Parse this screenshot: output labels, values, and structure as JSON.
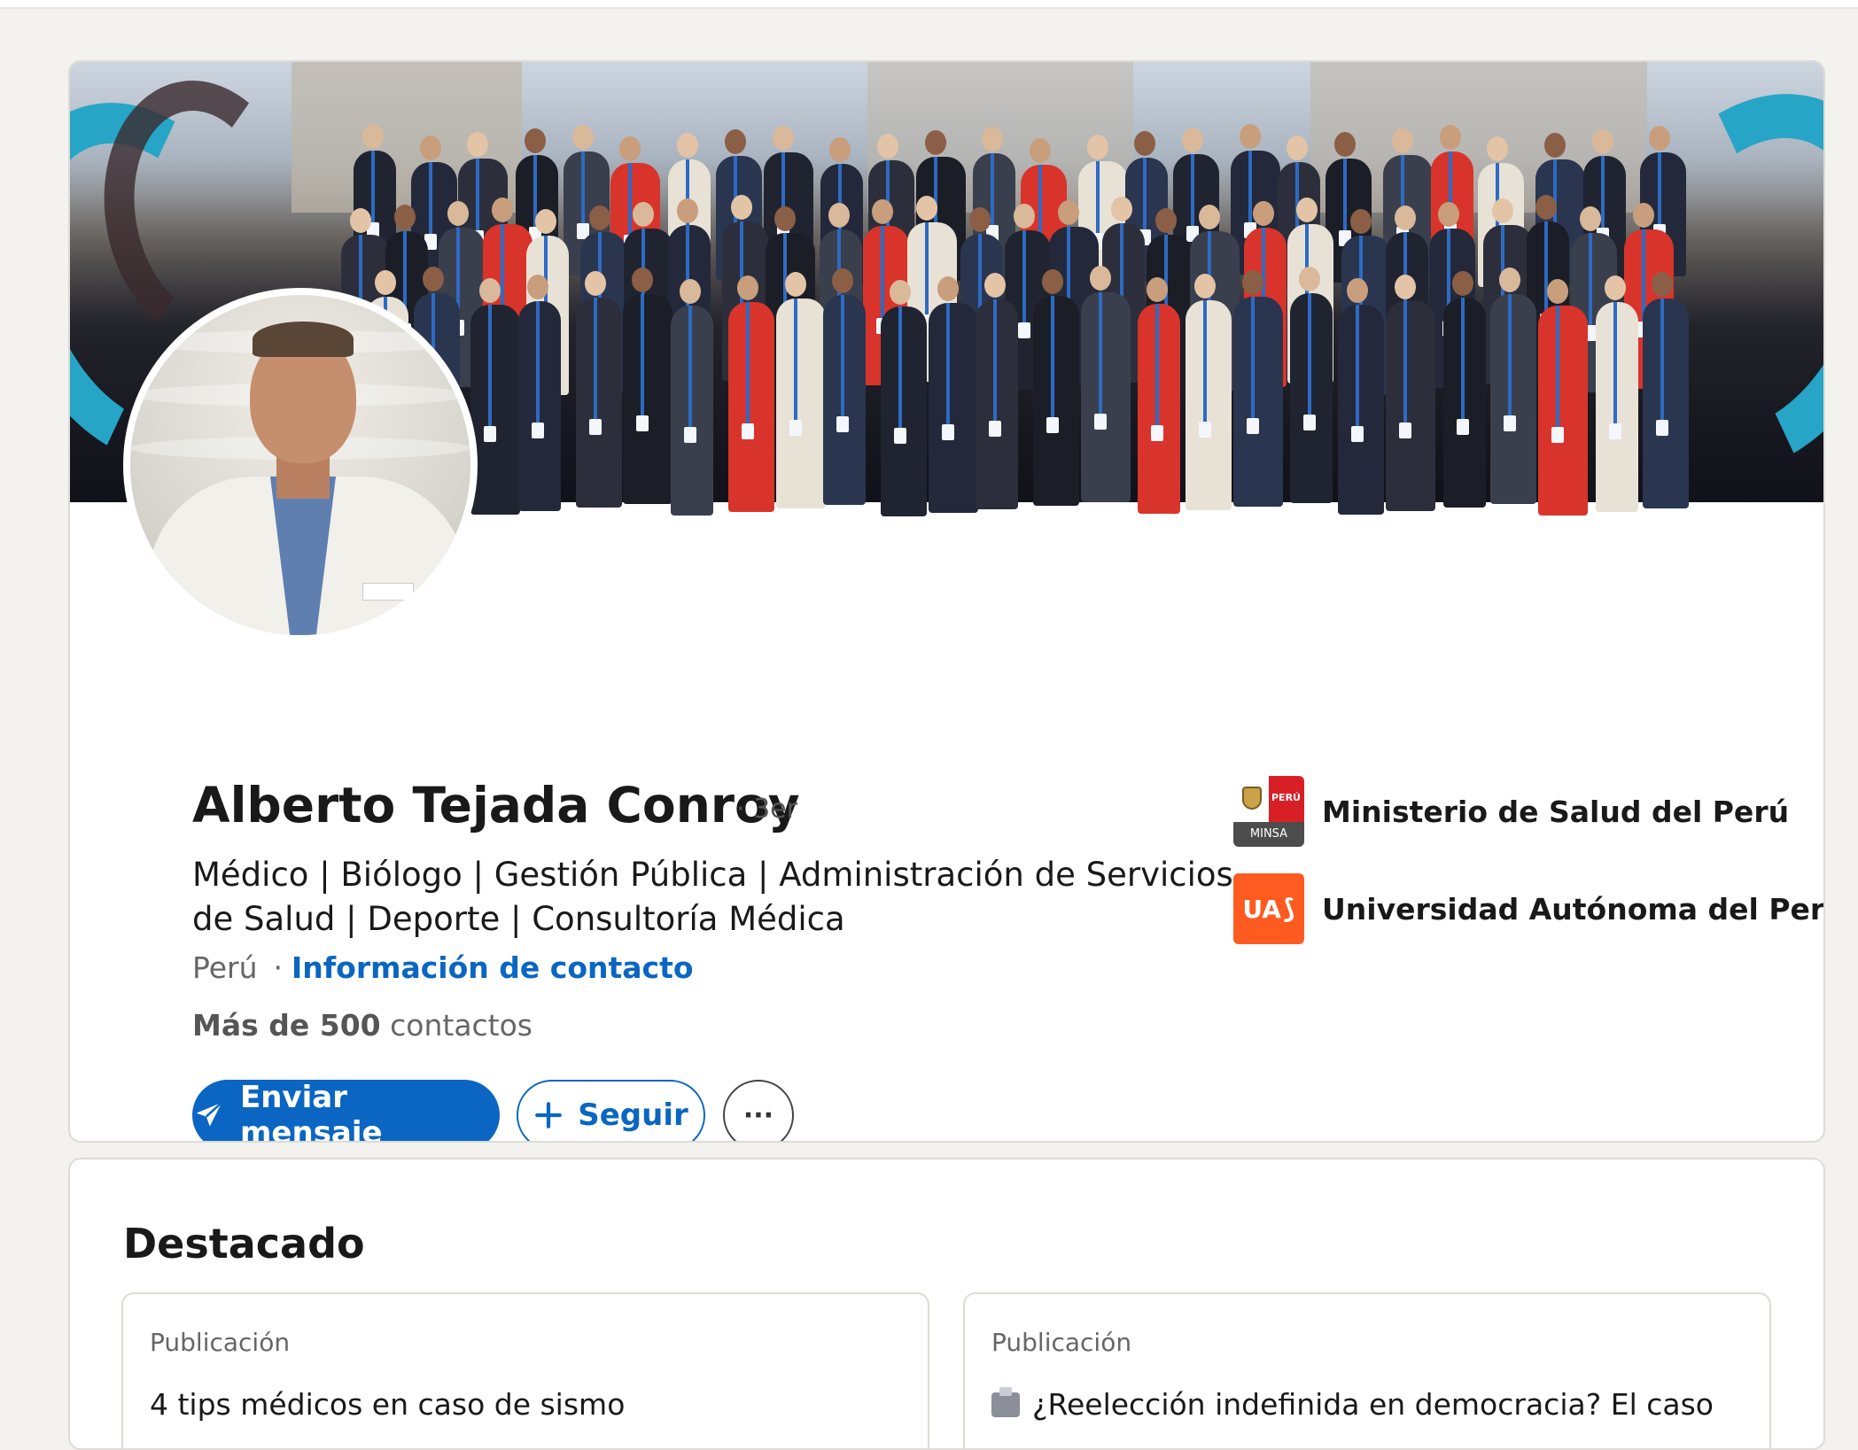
{
  "profile": {
    "name": "Alberto Tejada Conroy",
    "degree": "· 3er",
    "headline": "Médico | Biólogo | Gestión Pública | Administración de Servicios de Salud | Deporte | Consultoría Médica",
    "location": "Perú",
    "separator": "·",
    "contact_link": "Información de contacto",
    "connections_bold": "Más de 500",
    "connections_rest": "contactos"
  },
  "actions": {
    "message_label": "Enviar mensaje",
    "follow_label": "Seguir",
    "more_label": "···"
  },
  "icons": {
    "message": "send-icon",
    "follow": "plus-icon",
    "more": "ellipsis-icon"
  },
  "organizations": [
    {
      "name": "Ministerio de Salud del Perú",
      "logo_top": "PERÚ",
      "logo_bottom": "MINSA"
    },
    {
      "name": "Universidad Autónoma del Perú",
      "logo_text": "UA"
    }
  ],
  "featured": {
    "title": "Destacado",
    "items": [
      {
        "type": "Publicación",
        "text": "4 tips médicos en caso de sismo"
      },
      {
        "type": "Publicación",
        "text": "¿Reelección indefinida en democracia? El caso"
      }
    ]
  },
  "colors": {
    "accent": "#0a66c2",
    "background": "#f4f2ee",
    "minsa_red": "#d91f26",
    "ua_orange": "#ff5a1f"
  }
}
